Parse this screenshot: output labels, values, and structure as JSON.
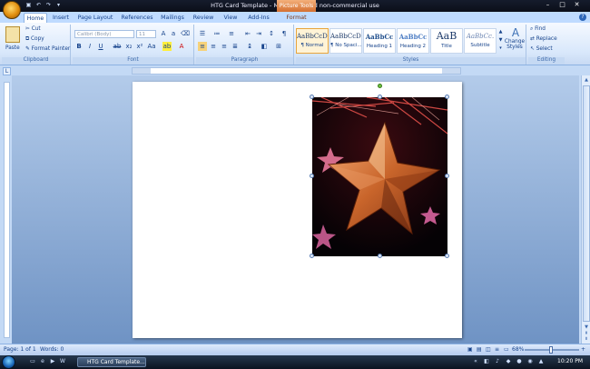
{
  "window": {
    "title": "HTG Card Template - Microsoft Word non-commercial use",
    "contextual_tab_group": "Picture Tools"
  },
  "tabs": [
    {
      "label": "Home",
      "active": true
    },
    {
      "label": "Insert"
    },
    {
      "label": "Page Layout"
    },
    {
      "label": "References"
    },
    {
      "label": "Mailings"
    },
    {
      "label": "Review"
    },
    {
      "label": "View"
    },
    {
      "label": "Add-Ins"
    },
    {
      "label": "Format",
      "contextual": true
    }
  ],
  "ribbon": {
    "clipboard": {
      "label": "Clipboard",
      "paste": "Paste",
      "cut": "Cut",
      "copy": "Copy",
      "format_painter": "Format Painter"
    },
    "font": {
      "label": "Font",
      "font_name": "Calibri (Body)",
      "font_size": "11"
    },
    "paragraph": {
      "label": "Paragraph"
    },
    "styles": {
      "label": "Styles",
      "items": [
        {
          "sample": "AaBbCcDc",
          "name": "¶ Normal",
          "selected": true
        },
        {
          "sample": "AaBbCcDc",
          "name": "¶ No Spaci..."
        },
        {
          "sample": "AaBbCc",
          "name": "Heading 1"
        },
        {
          "sample": "AaBbCc",
          "name": "Heading 2"
        },
        {
          "sample": "AaB",
          "name": "Title"
        },
        {
          "sample": "AaBbCc.",
          "name": "Subtitle"
        }
      ],
      "change_styles": "Change Styles"
    },
    "editing": {
      "label": "Editing",
      "find": "Find",
      "replace": "Replace",
      "select": "Select"
    }
  },
  "status": {
    "page": "Page: 1 of 1",
    "words": "Words: 0",
    "zoom": "68%"
  },
  "taskbar": {
    "task_label": "HTG Card Template...",
    "clock": "10:20 PM"
  },
  "colors": {
    "ribbon_blue": "#bfdbff",
    "doc_background": "#7f9fcf",
    "contextual_orange": "#d26b2c"
  }
}
